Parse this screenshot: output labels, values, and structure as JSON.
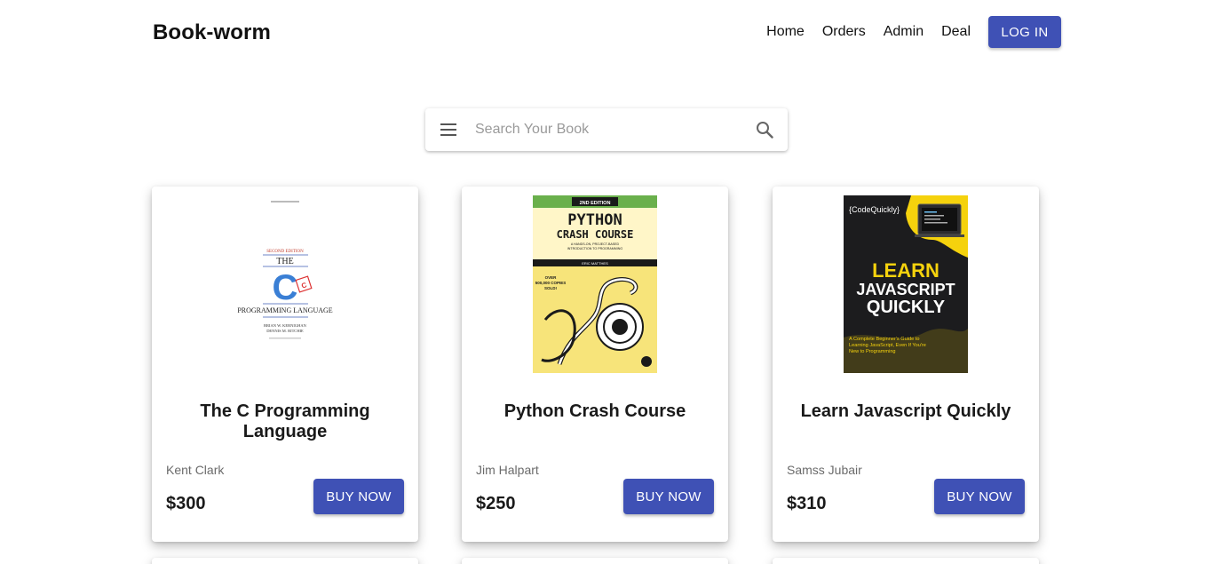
{
  "header": {
    "brand": "Book-worm",
    "nav": [
      "Home",
      "Orders",
      "Admin",
      "Deal"
    ],
    "login_label": "LOG IN"
  },
  "search": {
    "placeholder": "Search Your Book"
  },
  "books": [
    {
      "title": "The C Programming Language",
      "author": "Kent Clark",
      "price": "$300",
      "buy_label": "BUY NOW",
      "cover": {
        "edition": "SECOND EDITION",
        "the": "THE",
        "letter": "C",
        "heading": "PROGRAMMING LANGUAGE",
        "authors": "BRIAN W. KERNIGHAN\nDENNIS M. RITCHIE"
      }
    },
    {
      "title": "Python Crash Course",
      "author": "Jim Halpart",
      "price": "$250",
      "buy_label": "BUY NOW",
      "cover": {
        "edition": "2ND EDITION",
        "heading1": "PYTHON",
        "heading2": "CRASH COURSE",
        "subtitle": "A HANDS-ON, PROJECT-BASED INTRODUCTION TO PROGRAMMING",
        "author": "ERIC MATTHES",
        "sold": "OVER 500,000 COPIES SOLD!"
      }
    },
    {
      "title": "Learn Javascript Quickly",
      "author": "Samss Jubair",
      "price": "$310",
      "buy_label": "BUY NOW",
      "cover": {
        "publisher": "{CodeQuickly}",
        "line1": "LEARN",
        "line2": "JAVASCRIPT",
        "line3": "QUICKLY",
        "tagline": "A Complete Beginner's Guide to Learning JavaScript, Even If You're New to Programming"
      }
    }
  ],
  "colors": {
    "primary": "#3f51b5",
    "python_yellow": "#f7e47a",
    "js_dark": "#1c1c1e",
    "js_yellow": "#f5d20d"
  }
}
